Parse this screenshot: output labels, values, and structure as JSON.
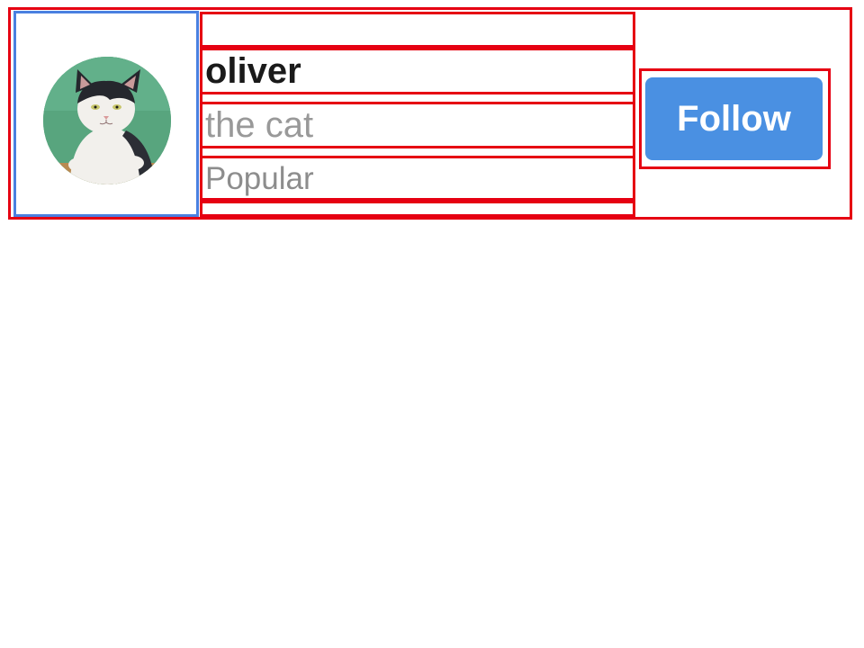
{
  "user": {
    "name": "oliver",
    "subtitle": "the cat",
    "badge": "Popular",
    "avatar_icon": "cat-photo-avatar"
  },
  "actions": {
    "follow_label": "Follow"
  },
  "colors": {
    "button_background": "#4a90e2",
    "name_text": "#1a1a1a",
    "subtitle_text": "#999999",
    "badge_text": "#8d8d8d",
    "annotation_outline": "#e60012",
    "selection_outline": "#4a80e0"
  }
}
